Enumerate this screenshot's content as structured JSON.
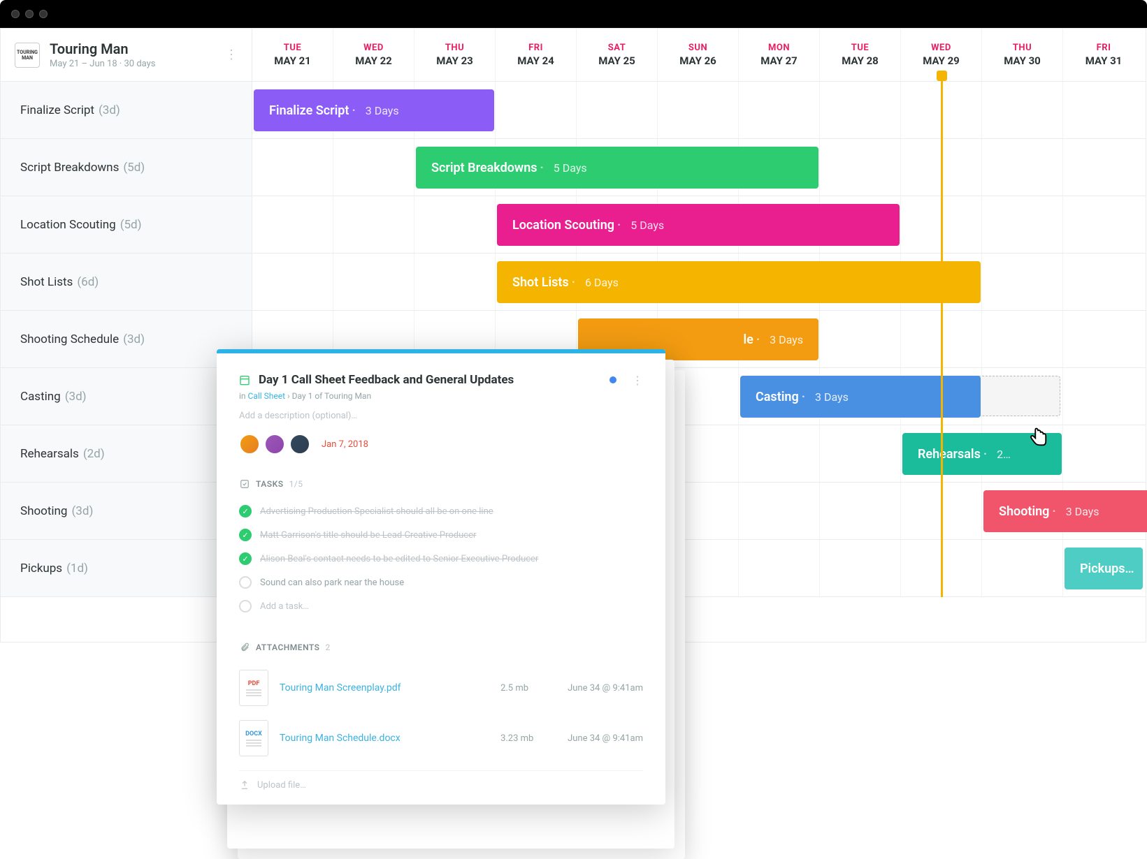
{
  "project": {
    "logo": "TOURING MAN",
    "title": "Touring Man",
    "subtitle": "May 21 – Jun 18  ·  30 days"
  },
  "days": [
    {
      "name": "TUE",
      "date": "MAY 21"
    },
    {
      "name": "WED",
      "date": "MAY 22"
    },
    {
      "name": "THU",
      "date": "MAY 23"
    },
    {
      "name": "FRI",
      "date": "MAY 24"
    },
    {
      "name": "SAT",
      "date": "MAY 25"
    },
    {
      "name": "SUN",
      "date": "MAY 26"
    },
    {
      "name": "MON",
      "date": "MAY 27"
    },
    {
      "name": "TUE",
      "date": "MAY 28"
    },
    {
      "name": "WED",
      "date": "MAY 29"
    },
    {
      "name": "THU",
      "date": "MAY 30"
    },
    {
      "name": "FRI",
      "date": "MAY 31"
    }
  ],
  "rows": [
    {
      "label": "Finalize Script",
      "dur": "(3d)",
      "bar": {
        "text": "Finalize Script",
        "durText": "3 Days",
        "startCol": 0,
        "span": 3,
        "color": "#8b5cf6"
      }
    },
    {
      "label": "Script Breakdowns",
      "dur": "(5d)",
      "bar": {
        "text": "Script Breakdowns",
        "durText": "5 Days",
        "startCol": 2,
        "span": 5,
        "color": "#2ecc71"
      }
    },
    {
      "label": "Location Scouting",
      "dur": "(5d)",
      "bar": {
        "text": "Location Scouting",
        "durText": "5 Days",
        "startCol": 3,
        "span": 5,
        "color": "#e91e8f"
      }
    },
    {
      "label": "Shot Lists",
      "dur": "(6d)",
      "bar": {
        "text": "Shot Lists",
        "durText": "6 Days",
        "startCol": 3,
        "span": 6,
        "color": "#f5b400"
      }
    },
    {
      "label": "Shooting Schedule",
      "dur": "(3d)",
      "bar": {
        "text": "le",
        "durText": "3 Days",
        "startCol": 4,
        "span": 3,
        "color": "#f39c12",
        "clipped": true
      }
    },
    {
      "label": "Casting",
      "dur": "(3d)",
      "bar": {
        "text": "Casting",
        "durText": "3 Days",
        "startCol": 6,
        "span": 3,
        "color": "#4a90e2",
        "ghost": {
          "startCol": 6,
          "span": 4
        }
      }
    },
    {
      "label": "Rehearsals",
      "dur": "(2d)",
      "bar": {
        "text": "Rehearsals",
        "durText": "2…",
        "startCol": 8,
        "span": 2,
        "color": "#1abc9c"
      }
    },
    {
      "label": "Shooting",
      "dur": "(3d)",
      "bar": {
        "text": "Shooting",
        "durText": "3 Days",
        "startCol": 9,
        "span": 3,
        "color": "#f1556c"
      }
    },
    {
      "label": "Pickups",
      "dur": "(1d)",
      "bar": {
        "text": "Pickups…",
        "durText": "",
        "startCol": 10,
        "span": 1,
        "color": "#4ecdc4"
      }
    }
  ],
  "card": {
    "title": "Day 1 Call Sheet Feedback and General Updates",
    "breadcrumb_prefix": "in ",
    "breadcrumb_link": "Call Sheet",
    "breadcrumb_sep": "  ›  ",
    "breadcrumb_tail": "Day 1 of Touring Man",
    "desc_placeholder": "Add a description (optional)…",
    "due_date": "Jan 7, 2018",
    "tasks_label": "TASKS",
    "tasks_count": "1/5",
    "tasks": [
      {
        "done": true,
        "text": "Advertising Production Specialist should all be on one line"
      },
      {
        "done": true,
        "text": "Matt Garrison's title should be Lead Creative Producer"
      },
      {
        "done": true,
        "text": "Alison Beal's contact needs to be edited to Senior Executive Producer"
      },
      {
        "done": false,
        "text": "Sound can also park near the house"
      }
    ],
    "task_add": "Add a task…",
    "attach_label": "ATTACHMENTS",
    "attach_count": "2",
    "attachments": [
      {
        "type": "PDF",
        "name": "Touring Man Screenplay.pdf",
        "size": "2.5 mb",
        "date": "June 34 @ 9:41am"
      },
      {
        "type": "DOCX",
        "name": "Touring Man Schedule.docx",
        "size": "3.23 mb",
        "date": "June 34 @ 9:41am"
      }
    ],
    "upload": "Upload file…"
  }
}
